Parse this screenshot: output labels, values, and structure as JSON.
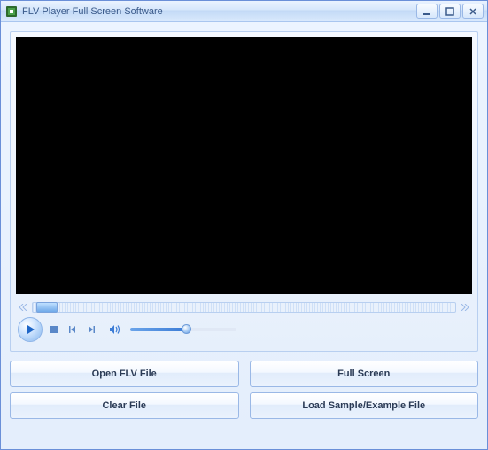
{
  "window": {
    "title": "FLV Player Full Screen Software"
  },
  "buttons": {
    "open": "Open FLV File",
    "fullscreen": "Full Screen",
    "clear": "Clear File",
    "load_sample": "Load Sample/Example File"
  }
}
